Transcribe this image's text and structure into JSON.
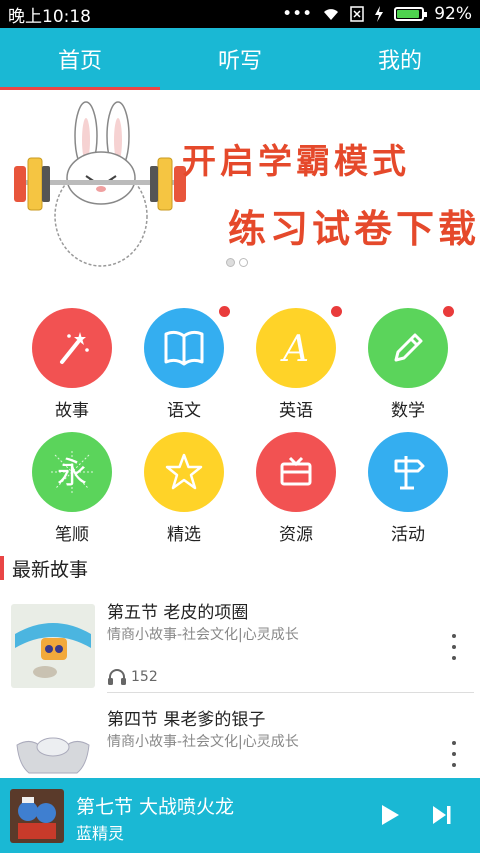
{
  "status_bar": {
    "time": "晚上10:18",
    "battery_percent_label": "92%",
    "battery_level": 0.92,
    "icons": [
      "dots-icon",
      "wifi-icon",
      "no-sim-icon",
      "charging-icon",
      "battery-icon"
    ]
  },
  "tabs": [
    {
      "label": "首页",
      "active": true
    },
    {
      "label": "听写",
      "active": false
    },
    {
      "label": "我的",
      "active": false
    }
  ],
  "banner": {
    "line1": "开启学霸模式",
    "line2": "练习试卷下载",
    "pages": 2,
    "current_page": 1
  },
  "categories": [
    {
      "label": "故事",
      "color": "#f25252",
      "icon": "magic-wand-icon",
      "badge": false
    },
    {
      "label": "语文",
      "color": "#34aef0",
      "icon": "book-icon",
      "badge": true
    },
    {
      "label": "英语",
      "color": "#ffd328",
      "icon": "letter-a-icon",
      "badge": true
    },
    {
      "label": "数学",
      "color": "#5bd45b",
      "icon": "pencil-icon",
      "badge": true
    },
    {
      "label": "笔顺",
      "color": "#5bd45b",
      "icon": "stroke-order-icon",
      "badge": false
    },
    {
      "label": "精选",
      "color": "#ffd328",
      "icon": "star-icon",
      "badge": false
    },
    {
      "label": "资源",
      "color": "#f25252",
      "icon": "gift-box-icon",
      "badge": false
    },
    {
      "label": "活动",
      "color": "#34aef0",
      "icon": "signpost-icon",
      "badge": false
    }
  ],
  "section": {
    "title": "最新故事"
  },
  "stories": [
    {
      "title": "第五节 老皮的项圈",
      "subtitle": "情商小故事-社会文化|心灵成长",
      "plays": "152"
    },
    {
      "title": "第四节 果老爹的银子",
      "subtitle": "情商小故事-社会文化|心灵成长",
      "plays": ""
    }
  ],
  "player": {
    "title": "第七节 大战喷火龙",
    "artist": "蓝精灵"
  },
  "colors": {
    "accent": "#1ab8d4",
    "indicator": "#e94545",
    "banner_text": "#e5492b"
  }
}
